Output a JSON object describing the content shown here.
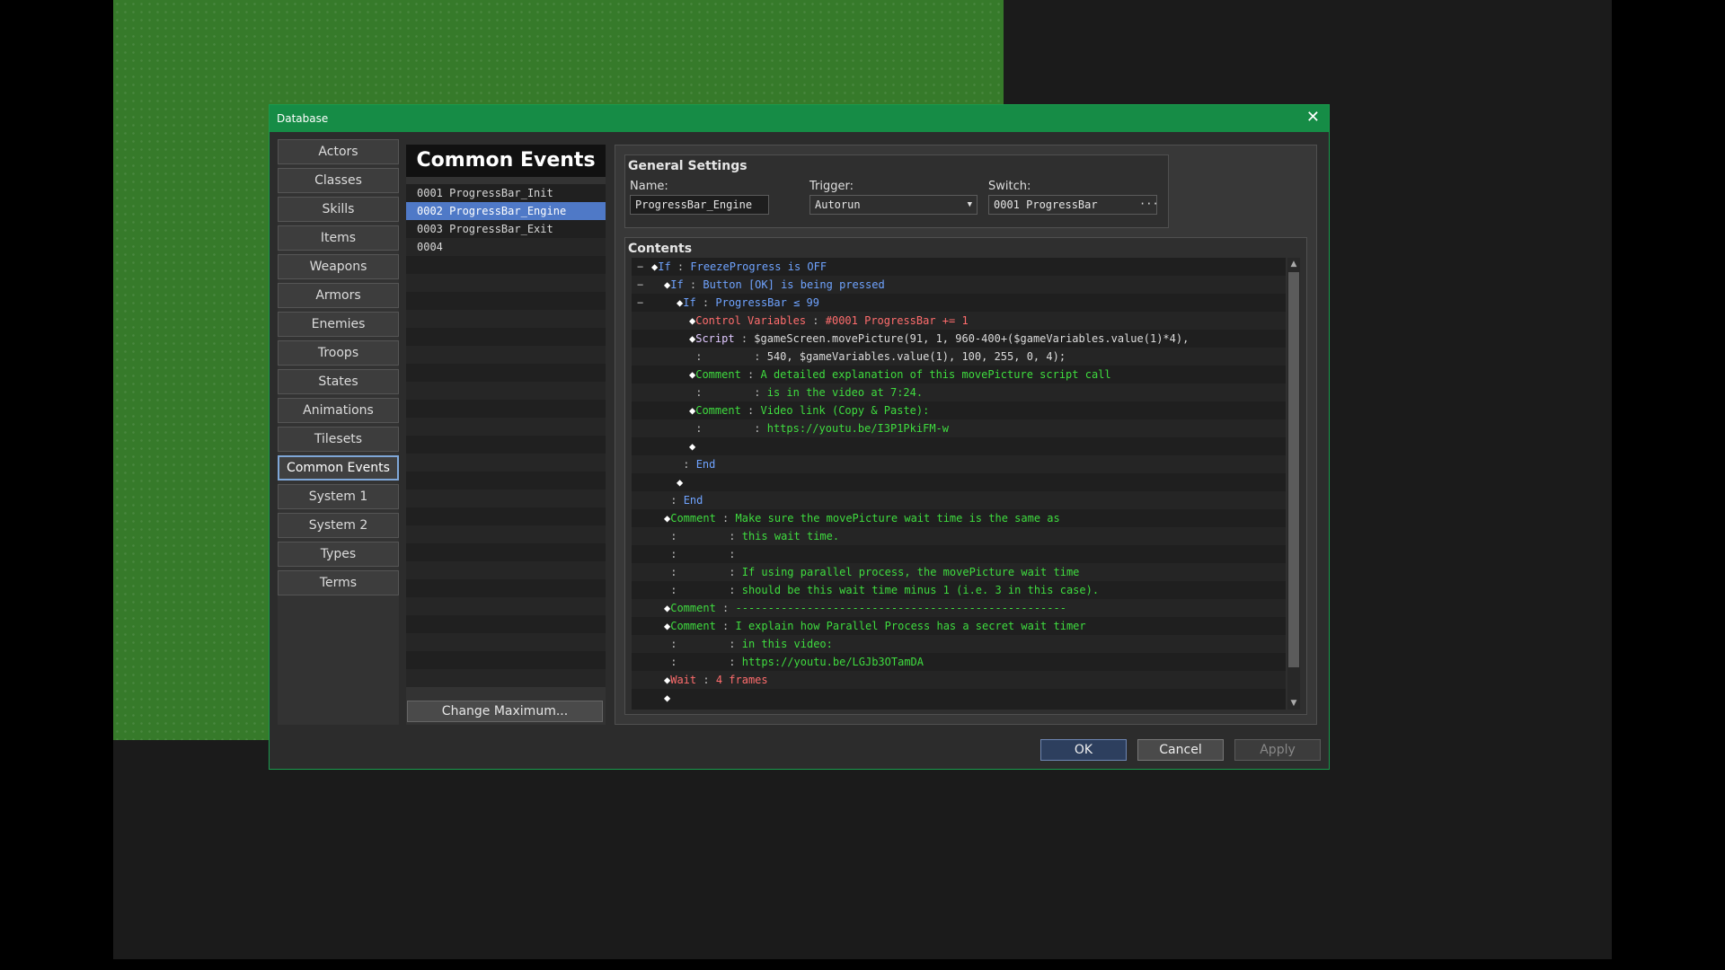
{
  "window": {
    "title": "Database",
    "close_glyph": "✕"
  },
  "sidebar": {
    "items": [
      {
        "label": "Actors"
      },
      {
        "label": "Classes"
      },
      {
        "label": "Skills"
      },
      {
        "label": "Items"
      },
      {
        "label": "Weapons"
      },
      {
        "label": "Armors"
      },
      {
        "label": "Enemies"
      },
      {
        "label": "Troops"
      },
      {
        "label": "States"
      },
      {
        "label": "Animations"
      },
      {
        "label": "Tilesets"
      },
      {
        "label": "Common Events",
        "active": true
      },
      {
        "label": "System 1"
      },
      {
        "label": "System 2"
      },
      {
        "label": "Types"
      },
      {
        "label": "Terms"
      }
    ]
  },
  "common_events": {
    "header": "Common Events",
    "items": [
      {
        "text": "0001  ProgressBar_Init"
      },
      {
        "text": "0002  ProgressBar_Engine",
        "selected": true
      },
      {
        "text": "0003  ProgressBar_Exit"
      },
      {
        "text": "0004"
      }
    ],
    "change_max_label": "Change Maximum..."
  },
  "general": {
    "title": "General Settings",
    "name_label": "Name:",
    "name_value": "ProgressBar_Engine",
    "trigger_label": "Trigger:",
    "trigger_value": "Autorun",
    "switch_label": "Switch:",
    "switch_value": "0001 ProgressBar",
    "switch_btn": "···"
  },
  "contents": {
    "title": "Contents",
    "lines": [
      {
        "fold": "−",
        "indent": 0,
        "marker": "◆",
        "parts": [
          [
            "c-if",
            "If"
          ],
          [
            "colon",
            " : "
          ],
          [
            "c-if",
            "FreezeProgress is OFF"
          ]
        ]
      },
      {
        "fold": "−",
        "indent": 1,
        "marker": "◆",
        "parts": [
          [
            "c-if",
            "If"
          ],
          [
            "colon",
            " : "
          ],
          [
            "c-if",
            "Button [OK] is being pressed"
          ]
        ]
      },
      {
        "fold": "−",
        "indent": 2,
        "marker": "◆",
        "parts": [
          [
            "c-if",
            "If"
          ],
          [
            "colon",
            " : "
          ],
          [
            "c-if",
            "ProgressBar ≤ 99"
          ]
        ]
      },
      {
        "indent": 3,
        "marker": "◆",
        "parts": [
          [
            "c-var",
            "Control Variables"
          ],
          [
            "colon",
            " : "
          ],
          [
            "c-var",
            "#0001 ProgressBar += 1"
          ]
        ]
      },
      {
        "indent": 3,
        "marker": "◆",
        "parts": [
          [
            "c-scr",
            "Script"
          ],
          [
            "colon",
            " : "
          ],
          [
            "c-scrtxt",
            "$gameScreen.movePicture(91, 1, 960-400+($gameVariables.value(1)*4),"
          ]
        ]
      },
      {
        "indent": 3,
        "marker": " ",
        "parts": [
          [
            "colon",
            ":        : "
          ],
          [
            "c-scrtxt",
            "540, $gameVariables.value(1), 100, 255, 0, 4);"
          ]
        ]
      },
      {
        "indent": 3,
        "marker": "◆",
        "parts": [
          [
            "c-com",
            "Comment"
          ],
          [
            "colon",
            " : "
          ],
          [
            "c-com",
            "A detailed explanation of this movePicture script call"
          ]
        ]
      },
      {
        "indent": 3,
        "marker": " ",
        "parts": [
          [
            "colon",
            ":        : "
          ],
          [
            "c-com",
            "is in the video at 7:24."
          ]
        ]
      },
      {
        "indent": 3,
        "marker": "◆",
        "parts": [
          [
            "c-com",
            "Comment"
          ],
          [
            "colon",
            " : "
          ],
          [
            "c-com",
            "Video link (Copy & Paste):"
          ]
        ]
      },
      {
        "indent": 3,
        "marker": " ",
        "parts": [
          [
            "colon",
            ":        : "
          ],
          [
            "c-com",
            "https://youtu.be/I3P1PkiFM-w"
          ]
        ]
      },
      {
        "indent": 3,
        "marker": "◆",
        "parts": []
      },
      {
        "indent": 2,
        "marker": " ",
        "parts": [
          [
            "colon",
            ": "
          ],
          [
            "c-if",
            "End"
          ]
        ]
      },
      {
        "indent": 2,
        "marker": "◆",
        "parts": []
      },
      {
        "indent": 1,
        "marker": " ",
        "parts": [
          [
            "colon",
            ": "
          ],
          [
            "c-if",
            "End"
          ]
        ]
      },
      {
        "indent": 1,
        "marker": "◆",
        "parts": [
          [
            "c-com",
            "Comment"
          ],
          [
            "colon",
            " : "
          ],
          [
            "c-com",
            "Make sure the movePicture wait time is the same as"
          ]
        ]
      },
      {
        "indent": 1,
        "marker": " ",
        "parts": [
          [
            "colon",
            ":        : "
          ],
          [
            "c-com",
            "this wait time."
          ]
        ]
      },
      {
        "indent": 1,
        "marker": " ",
        "parts": [
          [
            "colon",
            ":        : "
          ]
        ]
      },
      {
        "indent": 1,
        "marker": " ",
        "parts": [
          [
            "colon",
            ":        : "
          ],
          [
            "c-com",
            "If using parallel process, the movePicture wait time"
          ]
        ]
      },
      {
        "indent": 1,
        "marker": " ",
        "parts": [
          [
            "colon",
            ":        : "
          ],
          [
            "c-com",
            "should be this wait time minus 1 (i.e. 3 in this case)."
          ]
        ]
      },
      {
        "indent": 1,
        "marker": "◆",
        "parts": [
          [
            "c-com",
            "Comment"
          ],
          [
            "colon",
            " : "
          ],
          [
            "c-com",
            "---------------------------------------------------"
          ]
        ]
      },
      {
        "indent": 1,
        "marker": "◆",
        "parts": [
          [
            "c-com",
            "Comment"
          ],
          [
            "colon",
            " : "
          ],
          [
            "c-com",
            "I explain how Parallel Process has a secret wait timer"
          ]
        ]
      },
      {
        "indent": 1,
        "marker": " ",
        "parts": [
          [
            "colon",
            ":        : "
          ],
          [
            "c-com",
            "in this video:"
          ]
        ]
      },
      {
        "indent": 1,
        "marker": " ",
        "parts": [
          [
            "colon",
            ":        : "
          ],
          [
            "c-com",
            "https://youtu.be/LGJb3OTamDA"
          ]
        ]
      },
      {
        "indent": 1,
        "marker": "◆",
        "parts": [
          [
            "c-wait",
            "Wait"
          ],
          [
            "colon",
            " : "
          ],
          [
            "c-wait",
            "4 frames"
          ]
        ]
      },
      {
        "indent": 1,
        "marker": "◆",
        "parts": []
      }
    ]
  },
  "buttons": {
    "ok": "OK",
    "cancel": "Cancel",
    "apply": "Apply"
  }
}
